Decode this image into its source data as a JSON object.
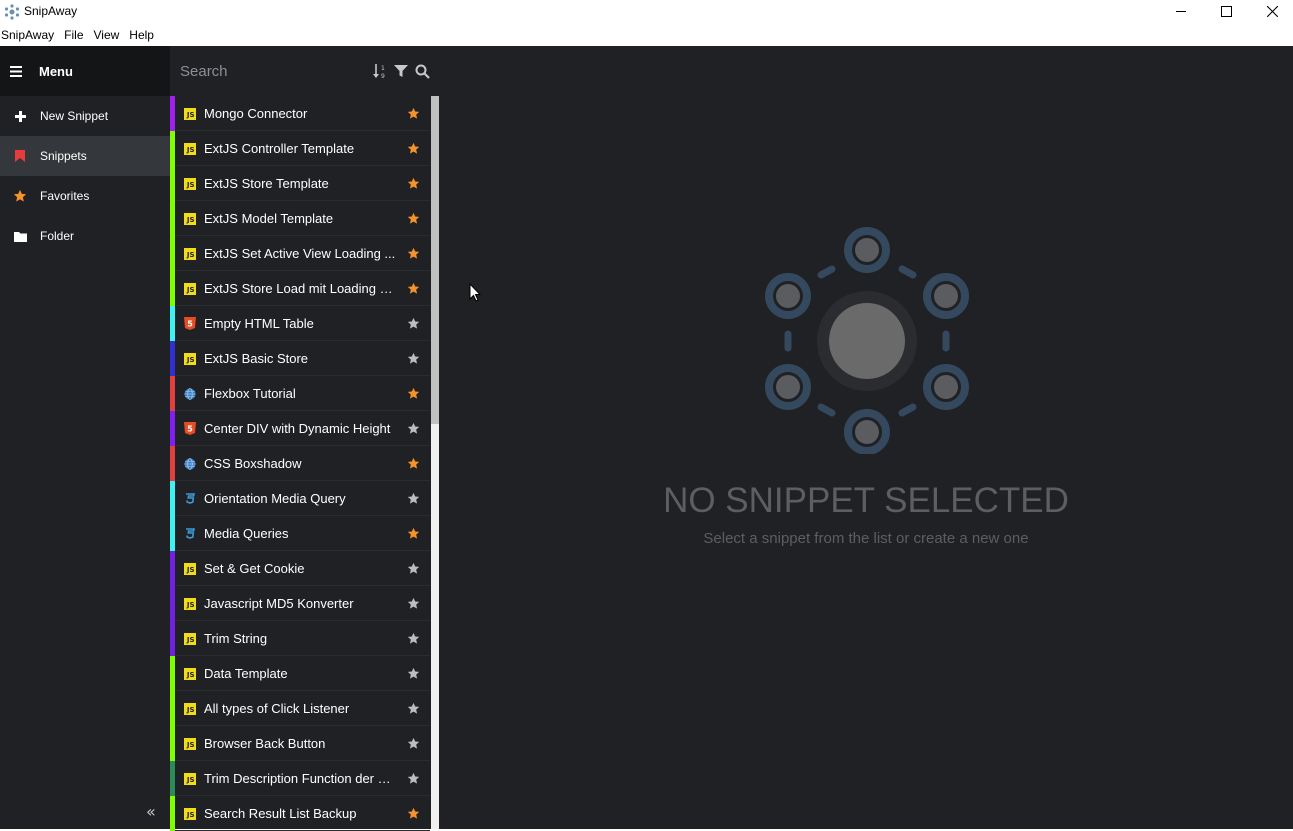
{
  "window": {
    "title": "SnipAway",
    "controls": [
      "minimize",
      "maximize",
      "close"
    ]
  },
  "menubar": [
    "SnipAway",
    "File",
    "View",
    "Help"
  ],
  "nav": {
    "header": "Menu",
    "items": [
      {
        "label": "New Snippet",
        "icon": "plus-icon",
        "active": false
      },
      {
        "label": "Snippets",
        "icon": "bookmark-icon",
        "active": true
      },
      {
        "label": "Favorites",
        "icon": "star-icon",
        "active": false
      },
      {
        "label": "Folder",
        "icon": "folder-icon",
        "active": false
      }
    ],
    "collapse_icon": "«"
  },
  "search": {
    "placeholder": "Search"
  },
  "snippets": [
    {
      "name": "Mongo Connector",
      "lang": "js",
      "color": "#a020f0",
      "favorite": true
    },
    {
      "name": "ExtJS Controller Template",
      "lang": "js",
      "color": "#7fff00",
      "favorite": true
    },
    {
      "name": "ExtJS Store Template",
      "lang": "js",
      "color": "#7fff00",
      "favorite": true
    },
    {
      "name": "ExtJS Model Template",
      "lang": "js",
      "color": "#7fff00",
      "favorite": true
    },
    {
      "name": "ExtJS Set Active View Loading ...",
      "lang": "js",
      "color": "#7fff00",
      "favorite": true
    },
    {
      "name": "ExtJS Store Load mit Loading M...",
      "lang": "js",
      "color": "#7fff00",
      "favorite": true
    },
    {
      "name": "Empty HTML Table",
      "lang": "html",
      "color": "#3ff2f2",
      "favorite": false
    },
    {
      "name": "ExtJS Basic Store",
      "lang": "js",
      "color": "#3030d0",
      "favorite": false
    },
    {
      "name": "Flexbox Tutorial",
      "lang": "web",
      "color": "#e04040",
      "favorite": true
    },
    {
      "name": "Center DIV with Dynamic Height",
      "lang": "html",
      "color": "#8020f0",
      "favorite": false
    },
    {
      "name": "CSS Boxshadow",
      "lang": "web",
      "color": "#e04040",
      "favorite": true
    },
    {
      "name": "Orientation Media Query",
      "lang": "css",
      "color": "#3ff2f2",
      "favorite": false
    },
    {
      "name": "Media Queries",
      "lang": "css",
      "color": "#3ff2f2",
      "favorite": true
    },
    {
      "name": "Set & Get Cookie",
      "lang": "js",
      "color": "#7020e0",
      "favorite": false
    },
    {
      "name": "Javascript MD5 Konverter",
      "lang": "js",
      "color": "#7020e0",
      "favorite": false
    },
    {
      "name": "Trim String",
      "lang": "js",
      "color": "#7020e0",
      "favorite": false
    },
    {
      "name": "Data Template",
      "lang": "js",
      "color": "#7fff00",
      "favorite": false
    },
    {
      "name": "All types of Click Listener",
      "lang": "js",
      "color": "#7fff00",
      "favorite": false
    },
    {
      "name": "Browser Back Button",
      "lang": "js",
      "color": "#7fff00",
      "favorite": false
    },
    {
      "name": "Trim Description Function der C...",
      "lang": "js",
      "color": "#2e8b57",
      "favorite": false
    },
    {
      "name": "Search Result List Backup",
      "lang": "js",
      "color": "#7fff00",
      "favorite": true
    }
  ],
  "main": {
    "empty_title": "NO SNIPPET SELECTED",
    "empty_subtitle": "Select a snippet from the list or create a new one"
  },
  "colors": {
    "background": "#1f2125",
    "favorite_star": "#f5922b",
    "inactive_star": "#bdbdbd",
    "illustration": "#34495e"
  }
}
